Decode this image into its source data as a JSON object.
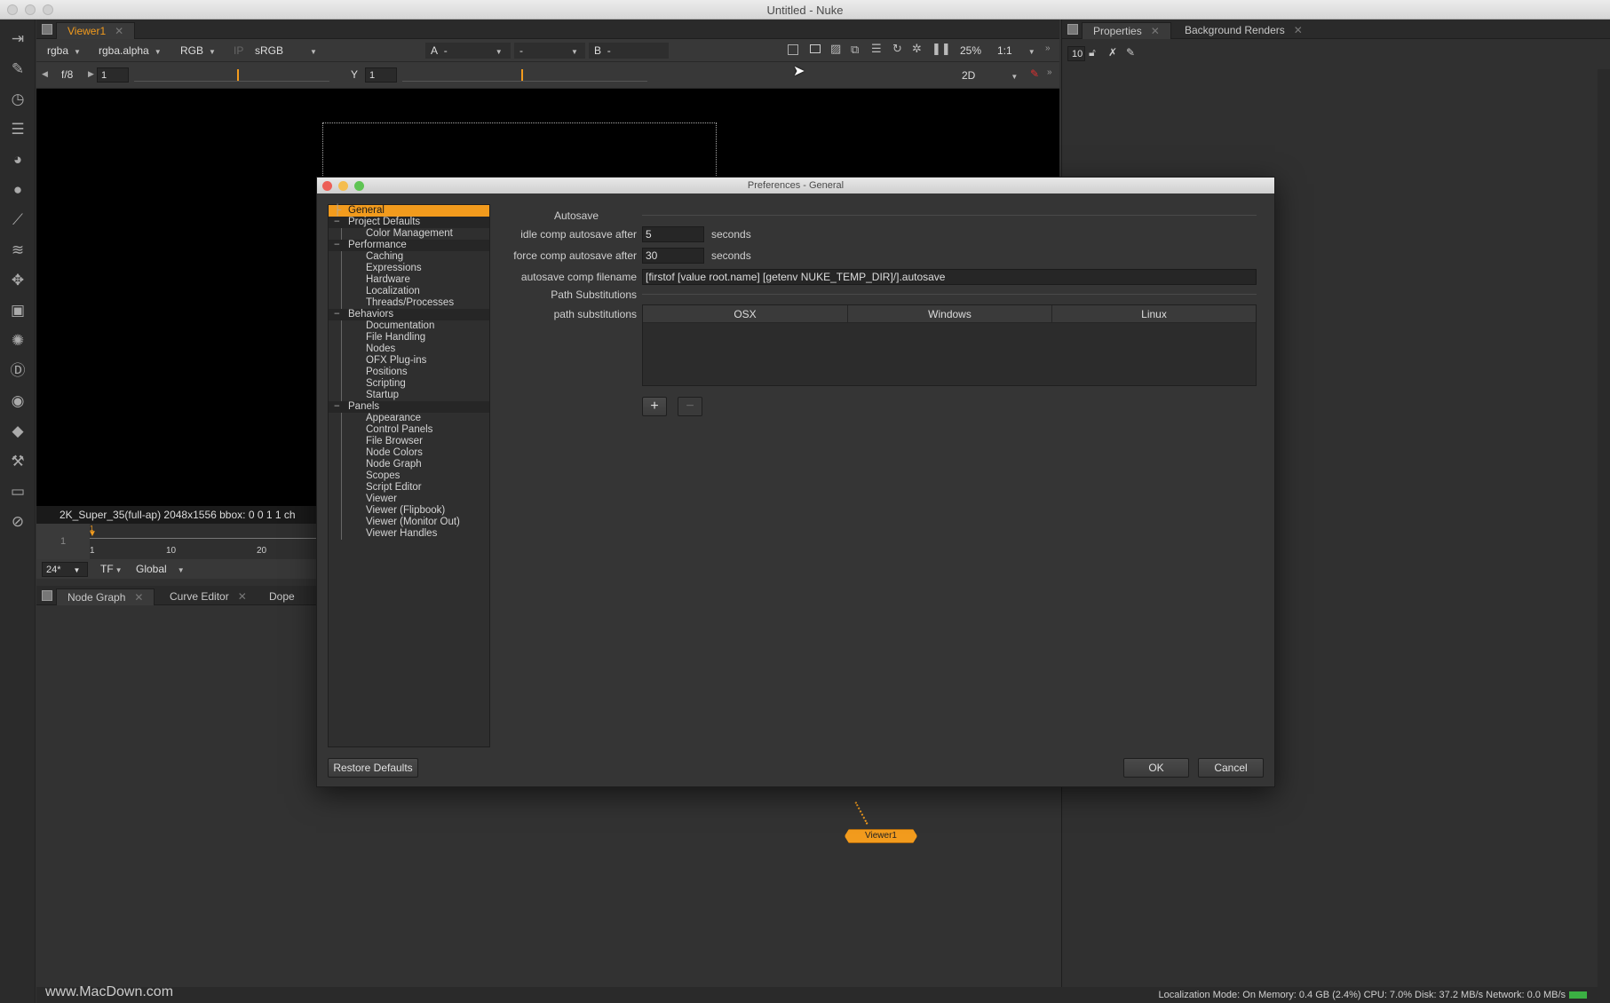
{
  "window": {
    "title": "Untitled - Nuke"
  },
  "left_toolbar": {
    "tools": [
      "image-icon",
      "draw-icon",
      "time-icon",
      "channel-icon",
      "color-icon",
      "filter-icon",
      "keyer-icon",
      "merge-icon",
      "transform-icon",
      "3d-icon",
      "particles-icon",
      "deep-icon",
      "views-icon",
      "metadata-icon",
      "toolsets-icon",
      "other-icon",
      "furnace-icon"
    ]
  },
  "viewer": {
    "tab_label": "Viewer1",
    "channels": "rgba",
    "alpha": "rgba.alpha",
    "display_channels": "RGB",
    "ip_label": "IP",
    "lut": "sRGB",
    "input_a_label": "A",
    "input_a_value": "-",
    "composite_value": "-",
    "input_b_label": "B",
    "input_b_value": "-",
    "zoom": "25%",
    "ratio": "1:1",
    "fstop_label": "f/8",
    "gain_value": "1",
    "gamma_label": "Y",
    "gamma_value": "1",
    "view_mode": "2D",
    "format_info": "2K_Super_35(full-ap) 2048x1556  bbox: 0 0 1 1 ch",
    "timeline": {
      "current_frame": "1",
      "start_mark": "1",
      "ticks": [
        "1",
        "10",
        "20"
      ]
    },
    "fps": "24*",
    "tf_label": "TF",
    "range_mode": "Global"
  },
  "bottom_panel": {
    "tabs": [
      {
        "label": "Node Graph"
      },
      {
        "label": "Curve Editor"
      },
      {
        "label": "Dope She"
      }
    ],
    "node": {
      "label": "Viewer1"
    }
  },
  "properties_panel": {
    "tabs": [
      {
        "label": "Properties"
      },
      {
        "label": "Background Renders"
      }
    ],
    "max_panels": "10"
  },
  "preferences": {
    "title": "Preferences - General",
    "tree": [
      {
        "label": "General",
        "level": 0,
        "selected": true
      },
      {
        "label": "Project Defaults",
        "level": 0
      },
      {
        "label": "Color Management",
        "level": 1
      },
      {
        "label": "Performance",
        "level": 0
      },
      {
        "label": "Caching",
        "level": 1
      },
      {
        "label": "Expressions",
        "level": 1
      },
      {
        "label": "Hardware",
        "level": 1
      },
      {
        "label": "Localization",
        "level": 1
      },
      {
        "label": "Threads/Processes",
        "level": 1
      },
      {
        "label": "Behaviors",
        "level": 0
      },
      {
        "label": "Documentation",
        "level": 1
      },
      {
        "label": "File Handling",
        "level": 1
      },
      {
        "label": "Nodes",
        "level": 1
      },
      {
        "label": "OFX Plug-ins",
        "level": 1
      },
      {
        "label": "Positions",
        "level": 1
      },
      {
        "label": "Scripting",
        "level": 1
      },
      {
        "label": "Startup",
        "level": 1
      },
      {
        "label": "Panels",
        "level": 0
      },
      {
        "label": "Appearance",
        "level": 1
      },
      {
        "label": "Control Panels",
        "level": 1
      },
      {
        "label": "File Browser",
        "level": 1
      },
      {
        "label": "Node Colors",
        "level": 1
      },
      {
        "label": "Node Graph",
        "level": 1
      },
      {
        "label": "Scopes",
        "level": 1
      },
      {
        "label": "Script Editor",
        "level": 1
      },
      {
        "label": "Viewer",
        "level": 1
      },
      {
        "label": "Viewer (Flipbook)",
        "level": 1
      },
      {
        "label": "Viewer (Monitor Out)",
        "level": 1
      },
      {
        "label": "Viewer Handles",
        "level": 1
      }
    ],
    "autosave_section": "Autosave",
    "idle_label": "idle comp autosave after",
    "idle_value": "5",
    "force_label": "force comp autosave after",
    "force_value": "30",
    "seconds": "seconds",
    "filename_label": "autosave comp filename",
    "filename_value": "[firstof [value root.name] [getenv NUKE_TEMP_DIR]/].autosave",
    "path_section": "Path Substitutions",
    "path_label": "path substitutions",
    "columns": [
      "OSX",
      "Windows",
      "Linux"
    ],
    "add_label": "+",
    "remove_label": "−",
    "restore_label": "Restore Defaults",
    "ok_label": "OK",
    "cancel_label": "Cancel"
  },
  "status_bar": {
    "text": "Localization Mode: On  Memory: 0.4 GB (2.4%)  CPU: 7.0%  Disk: 37.2 MB/s  Network: 0.0 MB/s"
  },
  "watermark": "www.MacDown.com",
  "colors": {
    "accent": "#f29b1d",
    "background": "#323232"
  }
}
